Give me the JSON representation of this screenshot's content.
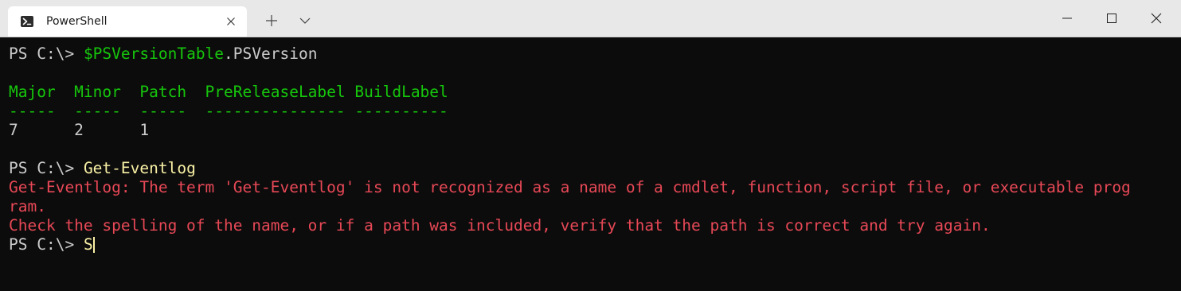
{
  "tab": {
    "title": "PowerShell"
  },
  "terminal": {
    "prompt": "PS C:\\>",
    "cmd1_var": "$PSVersionTable",
    "cmd1_prop": ".PSVersion",
    "headers": "Major  Minor  Patch  PreReleaseLabel BuildLabel",
    "separators": "-----  -----  -----  --------------- ----------",
    "values": "7      2      1",
    "cmd2": "Get-Eventlog",
    "error_line1": "Get-Eventlog: The term 'Get-Eventlog' is not recognized as a name of a cmdlet, function, script file, or executable prog",
    "error_line2": "ram.",
    "error_line3": "Check the spelling of the name, or if a path was included, verify that the path is correct and try again.",
    "cmd3": "S"
  },
  "colors": {
    "background": "#0c0c0c",
    "foreground": "#cccccc",
    "header_green": "#16c60c",
    "command_yellow": "#f9f1a5",
    "error_red": "#e74856",
    "titlebar": "#e8e8e8"
  },
  "icons": {
    "tab_icon": "powershell-icon",
    "tab_close": "close-icon",
    "new_tab": "plus-icon",
    "dropdown": "chevron-down-icon",
    "minimize": "minimize-icon",
    "maximize": "maximize-icon",
    "close": "close-icon"
  }
}
